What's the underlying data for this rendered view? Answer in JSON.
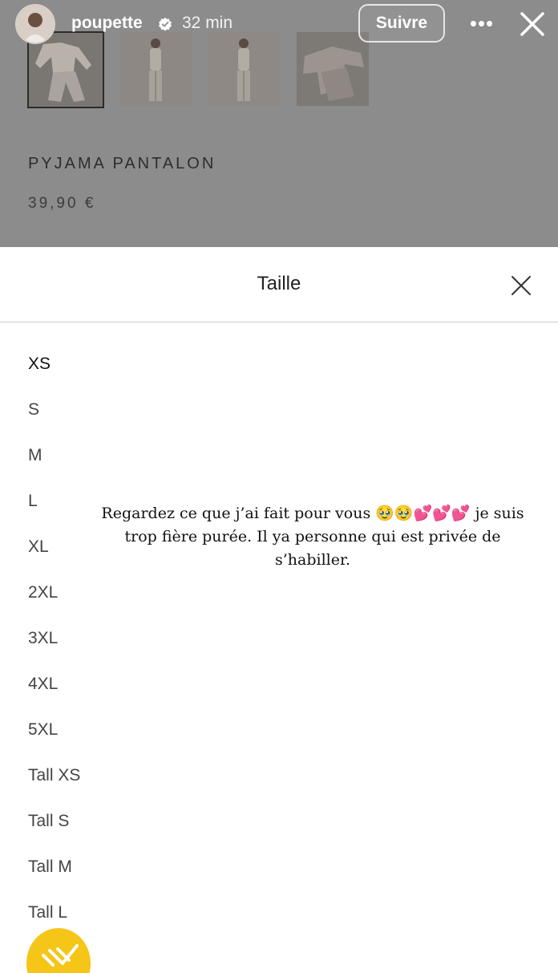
{
  "story": {
    "username": "poupette",
    "time_ago": "32 min",
    "follow_label": "Suivre",
    "more_label": "•••",
    "caption": "Regardez ce que j’ai fait pour vous 🥹🥹💕💕💕 je suis trop fière purée. Il ya personne qui est privée de s’habiller."
  },
  "product": {
    "name": "PYJAMA PANTALON",
    "price": "39,90 €"
  },
  "size_sheet": {
    "title": "Taille",
    "sizes": [
      "XS",
      "S",
      "M",
      "L",
      "XL",
      "2XL",
      "3XL",
      "4XL",
      "5XL",
      "Tall XS",
      "Tall S",
      "Tall M",
      "Tall L"
    ],
    "selected": "XS"
  },
  "colors": {
    "overlay": "#8c8c8c",
    "sticker": "#f5c518"
  }
}
